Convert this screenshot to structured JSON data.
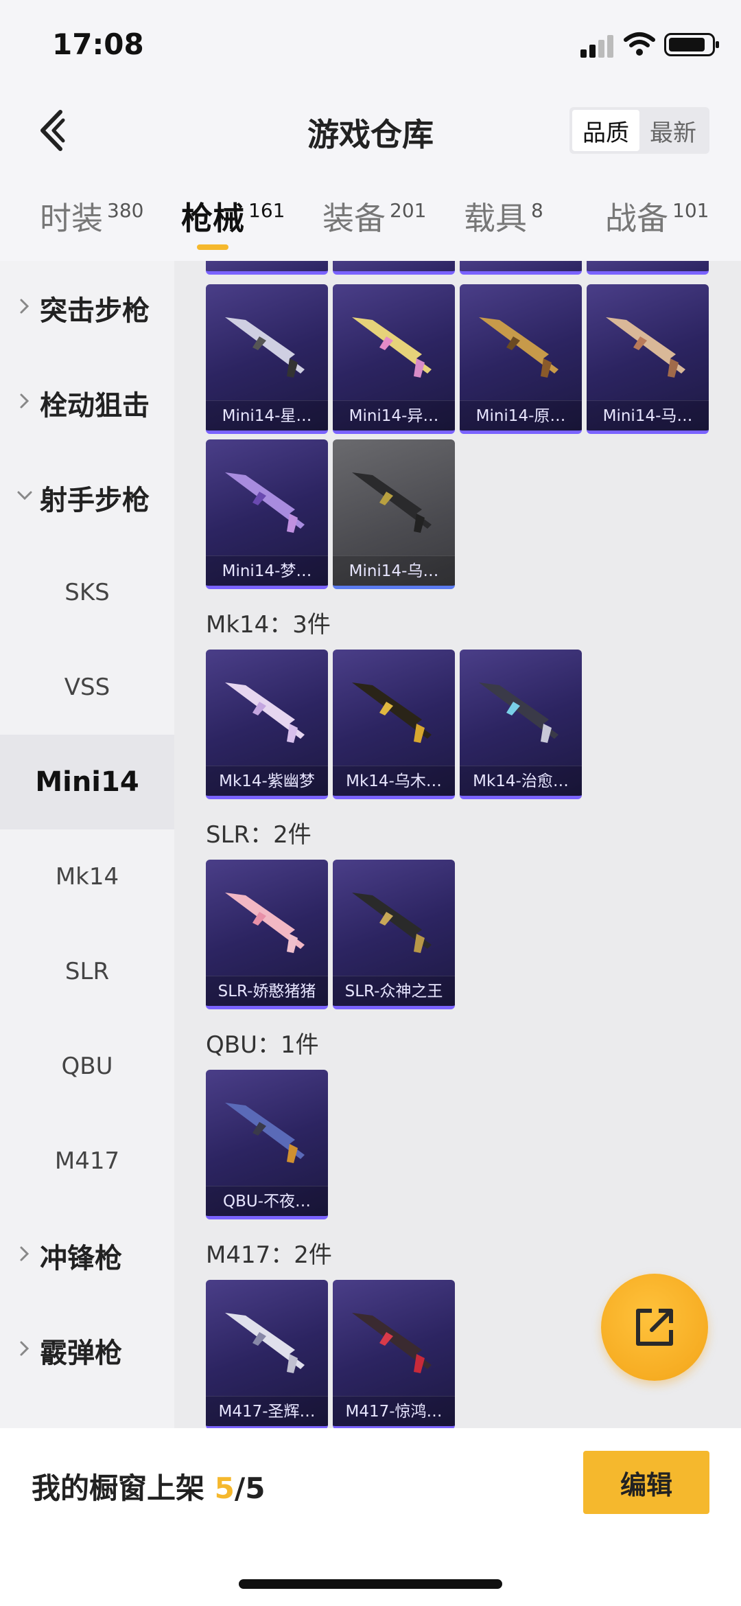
{
  "status": {
    "time": "17:08"
  },
  "header": {
    "title": "游戏仓库",
    "sort": [
      "品质",
      "最新"
    ]
  },
  "tabs": [
    {
      "label": "时装",
      "count": "380"
    },
    {
      "label": "枪械",
      "count": "161"
    },
    {
      "label": "装备",
      "count": "201"
    },
    {
      "label": "载具",
      "count": "8"
    },
    {
      "label": "战备",
      "count": "101"
    }
  ],
  "sidebar": {
    "cat1": "突击步枪",
    "cat2": "栓动狙击",
    "cat3": "射手步枪",
    "sub": [
      "SKS",
      "VSS",
      "Mini14",
      "Mk14",
      "SLR",
      "QBU",
      "M417"
    ],
    "cat4": "冲锋枪",
    "cat5": "霰弹枪"
  },
  "sections": {
    "mini14": [
      "Mini14-星…",
      "Mini14-异…",
      "Mini14-原…",
      "Mini14-马…",
      "Mini14-梦…",
      "Mini14-乌…"
    ],
    "mk14": {
      "title": "Mk14：3件",
      "items": [
        "Mk14-紫幽梦",
        "Mk14-乌木…",
        "Mk14-治愈…"
      ]
    },
    "slr": {
      "title": "SLR：2件",
      "items": [
        "SLR-娇憨猪猪",
        "SLR-众神之王"
      ]
    },
    "qbu": {
      "title": "QBU：1件",
      "items": [
        "QBU-不夜…"
      ]
    },
    "m417": {
      "title": "M417：2件",
      "items": [
        "M417-圣辉…",
        "M417-惊鸿…"
      ]
    }
  },
  "bottom": {
    "label": "我的橱窗上架 ",
    "count": "5",
    "total": "/5",
    "edit": "编辑"
  },
  "colors": {
    "accent": "#f5b82d",
    "card": "#2c2461"
  }
}
